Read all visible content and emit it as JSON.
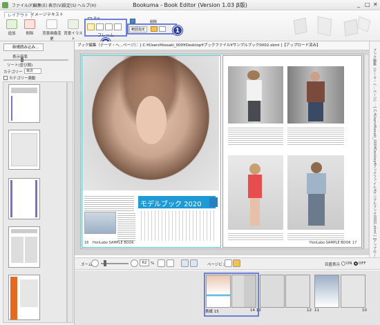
{
  "window": {
    "title": "Bookuma - Book Editor (Version 1.03 β版)",
    "menu": [
      "ファイル(F)",
      "編集(E)",
      "表示(V)",
      "設定(S)",
      "ヘルプ(H)"
    ],
    "controls": [
      "_",
      "□",
      "✕"
    ]
  },
  "ribbon": {
    "tabs": [
      "レイアウト",
      "イメージ",
      "テキスト"
    ],
    "active_tab": "レイアウト",
    "buttons": [
      "追加",
      "削除",
      "背景画像変更",
      "背景イラスト"
    ],
    "frame_label": "フレーム",
    "checkbox_label": "見出",
    "range_label": "範囲指定",
    "delete_label": "削除"
  },
  "badges": [
    "1",
    "2"
  ],
  "left_panel": {
    "new_load_button": "新規読み込み...",
    "display_ratio_label": "表示倍率",
    "sort_label": "ソート(並び順)",
    "category_label": "カテゴリー",
    "category_value": "目次",
    "category_link_label": "カテゴリー連動"
  },
  "pathbar": {
    "text": "ブック編集（テーマ・ヘ…ページ）：[ C:¥Users¥kosaki_000¥Desktop¥ブックファイル¥サンプルブック0002.xbml ]【アップロード済み】"
  },
  "right_edge": {
    "text": "ブック編集（テーマ・ヘ…ページ）：[ C:¥Users¥kosaki_000¥Desktop¥ブックファイル¥サンプルブック0002.xbml ]【アップロード済み】"
  },
  "document": {
    "title_banner": "モデルブック 2020",
    "left_footer": "HonLabo SAMPLE BOOK",
    "right_footer": "HonLabo SAMPLE BOOK",
    "left_page_no": "16",
    "right_page_no": "17"
  },
  "bottom_bar": {
    "zoom_label": "ズーム",
    "zoom_value": "62",
    "zoom_unit": "%",
    "preview_label": "ページビュー",
    "guide_label": "目盛表示",
    "on_label": "ON",
    "off_label": "OFF",
    "guide_value": "OFF"
  },
  "thumb_strip": {
    "numbers": [
      "表紙 15",
      "14 13",
      "12",
      "11",
      "10"
    ]
  },
  "colors": {
    "badge": "#2d3fa6",
    "highlight": "#6b7fd7",
    "banner": "#1e9bd7",
    "page_border": "#40c4d6",
    "spine_orange": "#e8691e"
  }
}
